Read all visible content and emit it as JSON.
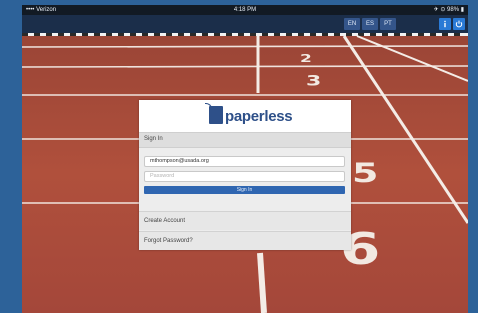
{
  "status_bar": {
    "carrier": "•••• Verizon ",
    "time": "4:18 PM",
    "battery": "✈ ⊙ 98% ▮"
  },
  "top_bar": {
    "languages": [
      "EN",
      "ES",
      "PT"
    ]
  },
  "track": {
    "lane_numbers": [
      "2",
      "3",
      "5",
      "6"
    ]
  },
  "login_card": {
    "logo_text": "paperless",
    "logo_tagline": "",
    "sign_in_heading": "Sign In",
    "email_value": "mthompson@usada.org",
    "password_placeholder": "Password",
    "sign_in_button": "Sign In",
    "create_account": "Create Account",
    "forgot_password": "Forgot Password?"
  },
  "colors": {
    "app_bar": "#1b2e4a",
    "accent": "#2f66b1",
    "track": "#a94a3a"
  },
  "icons": [
    "info-icon",
    "power-icon"
  ]
}
